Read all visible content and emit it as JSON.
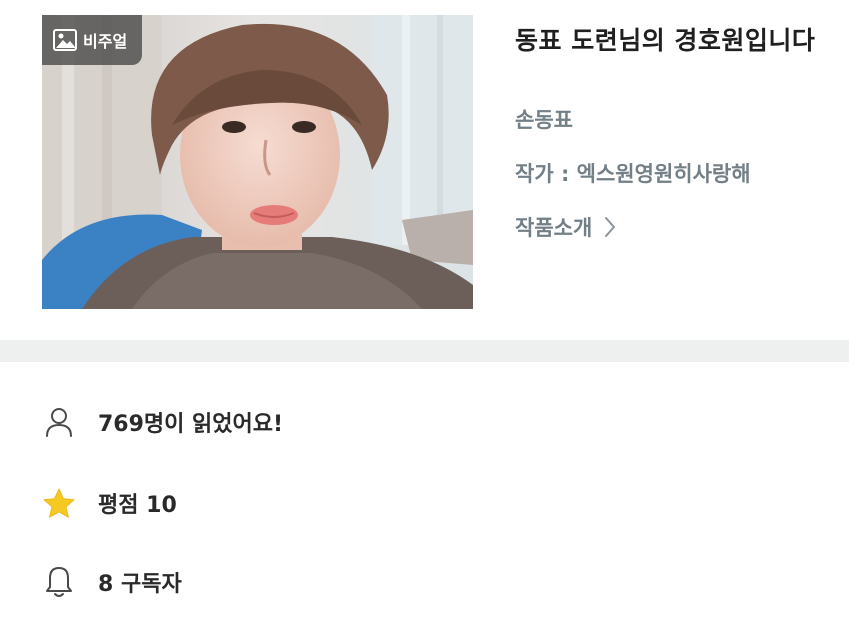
{
  "cover": {
    "badge_label": "비주얼",
    "badge_icon": "image-icon"
  },
  "work": {
    "title": "동표 도련님의 경호원입니다",
    "author_name": "손동표",
    "author_line": "작가 : 엑스원영원히사랑해",
    "intro_label": "작품소개"
  },
  "stats": {
    "readers": {
      "icon": "person-icon",
      "text": "769명이 읽었어요!"
    },
    "rating": {
      "icon": "star-icon",
      "text": "평점 10",
      "star_color": "#f6c823"
    },
    "subscribers": {
      "icon": "bell-icon",
      "text": "8 구독자"
    }
  },
  "colors": {
    "divider": "#eef0f0",
    "meta_text": "#737f86",
    "title_text": "#1f1f1f"
  }
}
